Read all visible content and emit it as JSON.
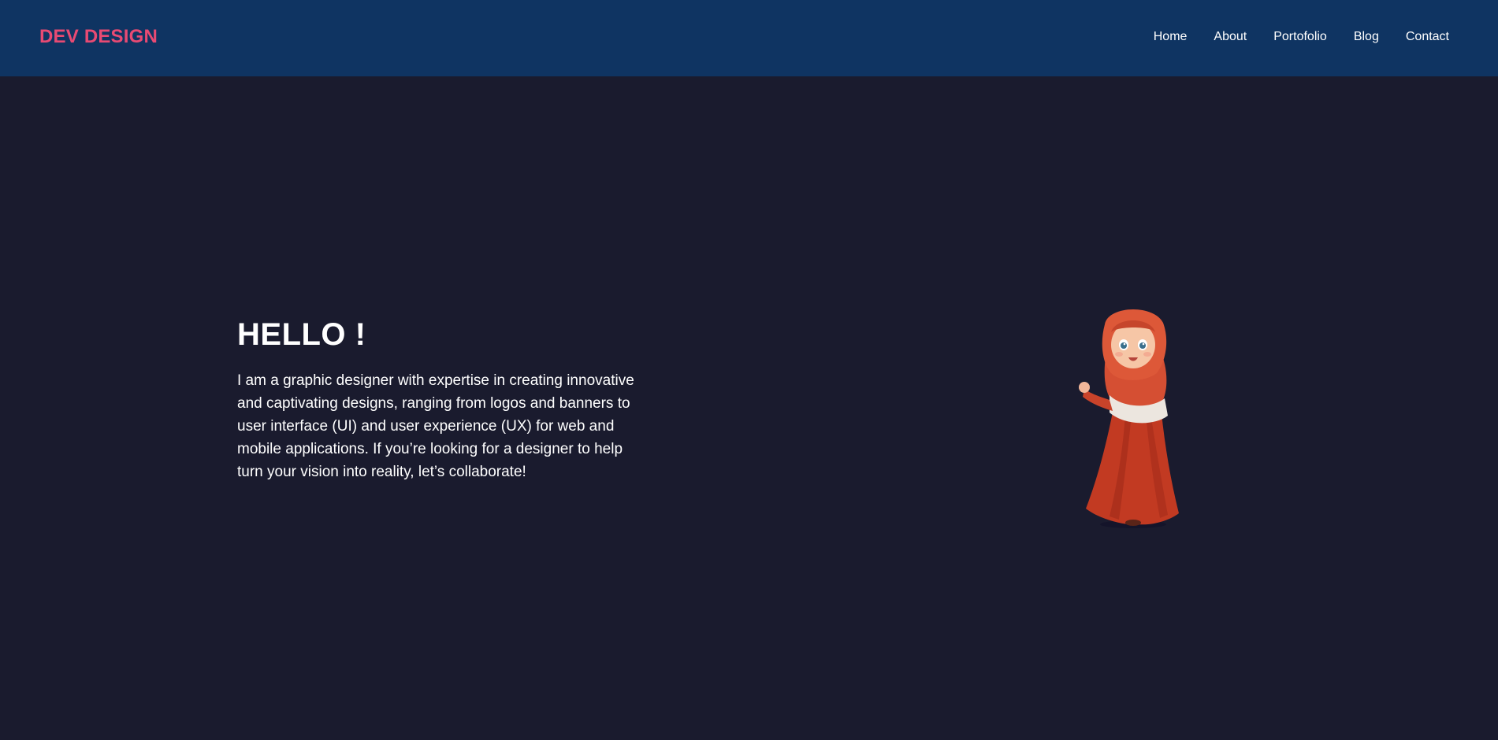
{
  "brand": {
    "logo_text": "DEV DESIGN",
    "accent_color": "#e84a73"
  },
  "nav": {
    "items": [
      {
        "label": "Home"
      },
      {
        "label": "About"
      },
      {
        "label": "Portofolio"
      },
      {
        "label": "Blog"
      },
      {
        "label": "Contact"
      }
    ]
  },
  "hero": {
    "title": "HELLO !",
    "description": "I am a graphic designer with expertise in creating innovative and captivating designs, ranging from logos and banners to user interface (UI) and user experience (UX) for web and mobile applications. If you’re looking for a designer to help turn your vision into reality, let’s collaborate!",
    "illustration": "girl-hijab-illustration"
  },
  "colors": {
    "header_bg": "#0f3462",
    "page_bg": "#1a1b2e",
    "text": "#ffffff"
  }
}
